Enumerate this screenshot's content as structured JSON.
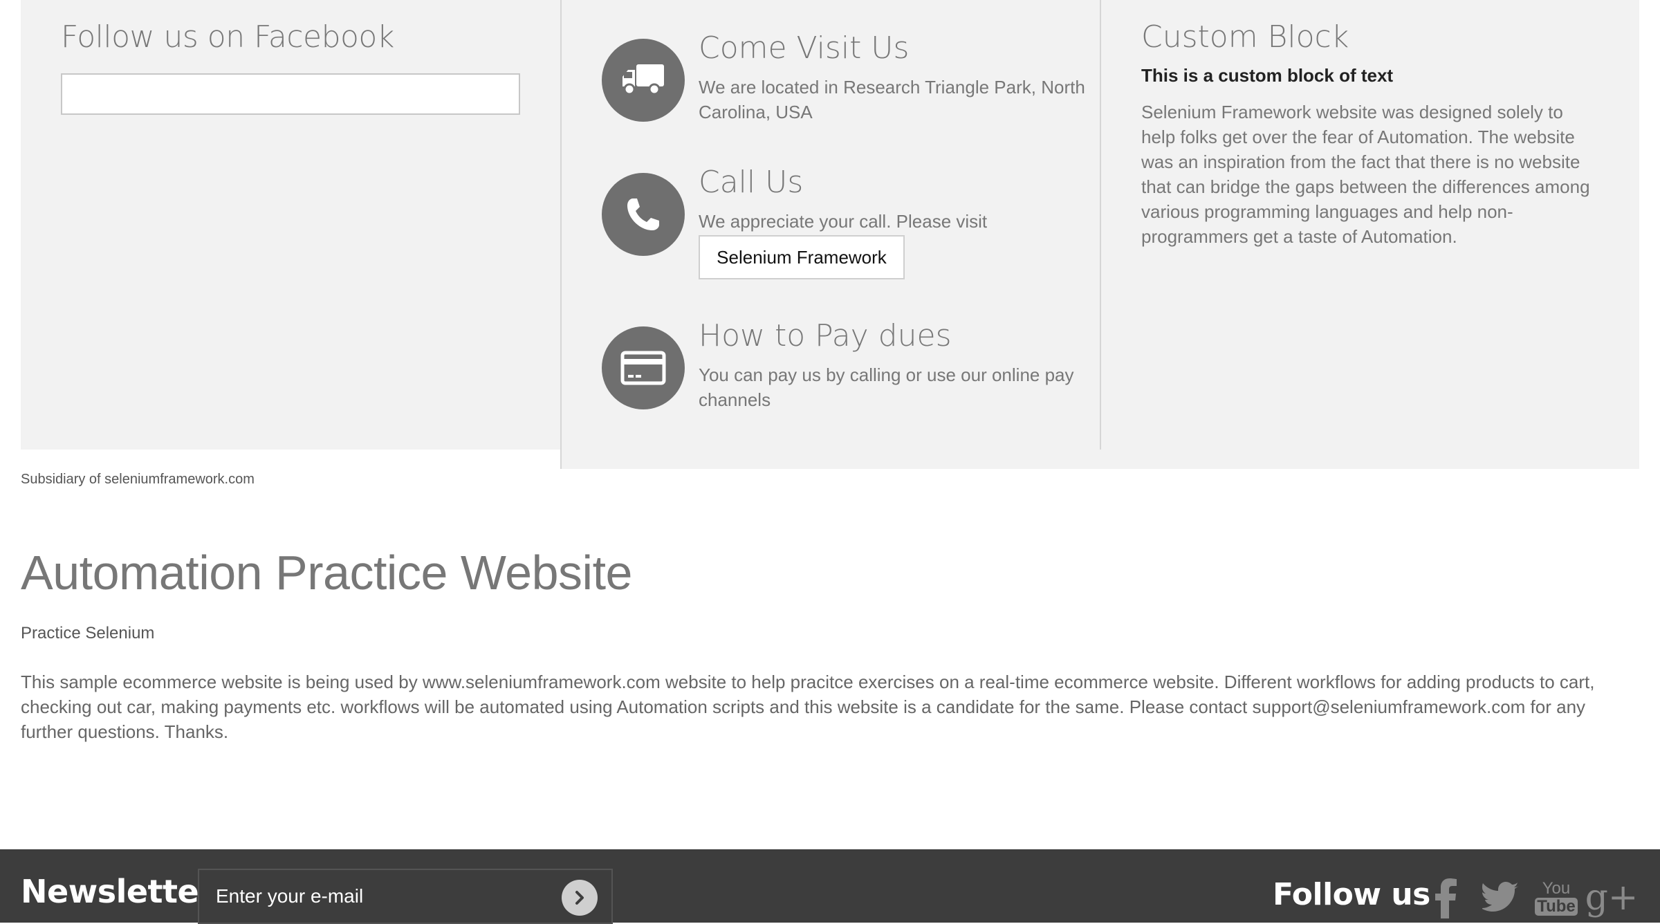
{
  "facebook": {
    "title": "Follow us on Facebook"
  },
  "info": {
    "visit": {
      "title": "Come Visit Us",
      "text": "We are located in Research Triangle Park, North Carolina, USA",
      "icon": "truck-icon"
    },
    "call": {
      "title": "Call Us",
      "text": "We appreciate your call. Please visit",
      "button": "Selenium Framework",
      "icon": "phone-icon"
    },
    "pay": {
      "title": "How to Pay dues",
      "text": "You can pay us by calling or use our online pay channels",
      "icon": "credit-card-icon"
    }
  },
  "custom_block": {
    "title": "Custom Block",
    "subtitle": "This is a custom block of text",
    "text": "Selenium Framework website was designed solely to help folks get over the fear of Automation. The website was an inspiration from the fact that there is no website that can bridge the gaps between the differences among various programming languages and help non-programmers get a taste of Automation."
  },
  "subsidiary": "Subsidiary of seleniumframework.com",
  "main": {
    "title": "Automation Practice Website",
    "subtitle": "Practice Selenium",
    "description": "This sample ecommerce website is being used by www.seleniumframework.com website to help pracitce exercises on a real-time ecommerce website. Different workflows for adding products to cart, checking out car, making payments etc. workflows will be automated using Automation scripts and this website is a candidate for the same. Please contact support@seleniumframework.com for any further questions. Thanks."
  },
  "footer": {
    "newsletter_label": "Newsletter",
    "email_placeholder": "Enter your e-mail",
    "follow_label": "Follow us",
    "social_icons": [
      "facebook-icon",
      "twitter-icon",
      "youtube-icon",
      "google-plus-icon"
    ],
    "youtube_glyph_top": "You",
    "youtube_glyph_bottom": "Tube",
    "google_plus_glyph": "g+"
  },
  "colors": {
    "panel_bg": "#f2f2f2",
    "footer_bg": "#3d3d3d",
    "icon_circle": "#6f6f6f",
    "text_gray": "#777777"
  }
}
